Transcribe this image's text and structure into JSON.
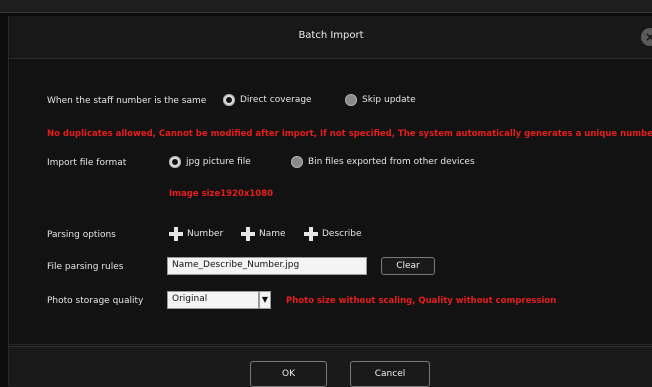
{
  "dialog": {
    "title": "Batch Import",
    "close_glyph": "×"
  },
  "staff_same": {
    "label": "When the staff number is the same",
    "options": [
      {
        "label": "Direct coverage",
        "selected": true
      },
      {
        "label": "Skip update",
        "selected": false
      }
    ]
  },
  "notice": "No duplicates allowed, Cannot be modified after import, If not specified, The system automatically generates a unique number.",
  "import_format": {
    "label": "Import file format",
    "options": [
      {
        "label": "jpg picture file",
        "selected": true
      },
      {
        "label": "Bin files exported from other devices",
        "selected": false
      }
    ],
    "image_size_note": "Image size1920x1080"
  },
  "parsing_options": {
    "label": "Parsing options",
    "items": [
      "Number",
      "Name",
      "Describe"
    ]
  },
  "file_parsing_rules": {
    "label": "File parsing rules",
    "value": "Name_Describe_Number.jpg",
    "clear_label": "Clear"
  },
  "photo_quality": {
    "label": "Photo storage quality",
    "selected": "Original",
    "note": "Photo size without scaling, Quality without compression"
  },
  "footer": {
    "ok_label": "OK",
    "cancel_label": "Cancel"
  },
  "colors": {
    "warning": "#e61e1e",
    "background": "#121212"
  }
}
